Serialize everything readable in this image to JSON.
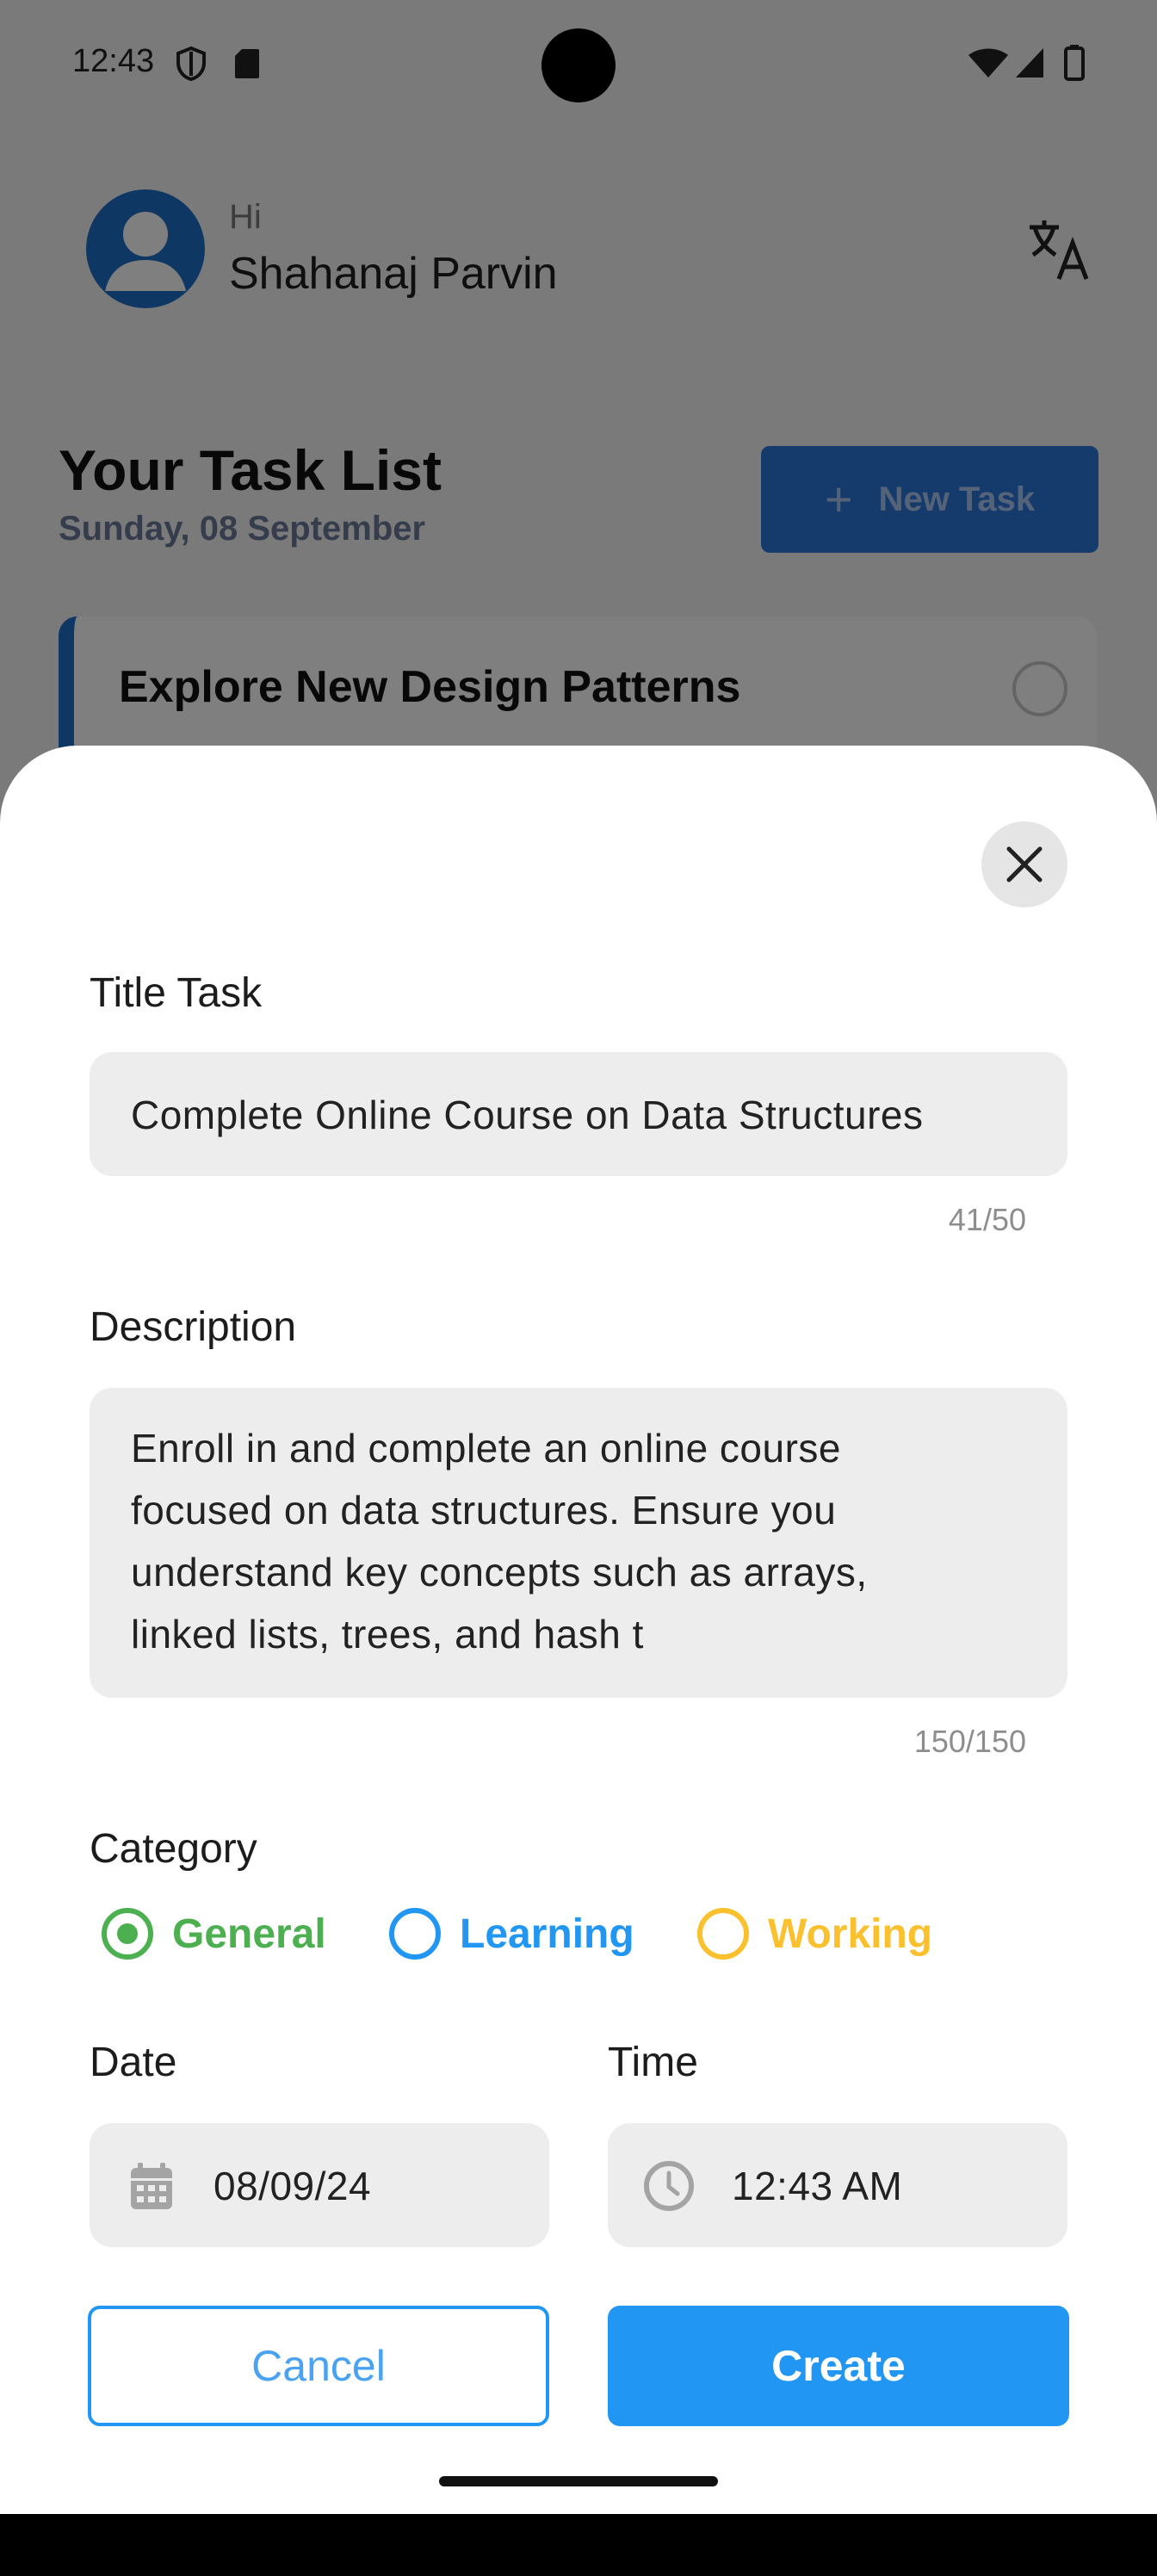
{
  "status_bar": {
    "time": "12:43",
    "left_icons": [
      "shield-icon",
      "sd-card-icon"
    ],
    "right_icons": [
      "wifi-icon",
      "signal-icon",
      "battery-icon"
    ]
  },
  "header": {
    "greeting": "Hi",
    "user_name": "Shahanaj Parvin",
    "avatar_icon": "person-avatar-icon",
    "language_icon": "translate-icon"
  },
  "task_list": {
    "title": "Your Task List",
    "date": "Sunday, 08 September",
    "new_task_label": "New Task",
    "tasks": [
      {
        "title": "Explore New Design Patterns"
      }
    ]
  },
  "sheet": {
    "close_icon": "close-icon",
    "title_label": "Title Task",
    "title_value": "Complete Online Course on Data Structures",
    "title_counter": "41/50",
    "description_label": "Description",
    "description_lines": [
      "Enroll in and complete an online course",
      "focused on data structures. Ensure you",
      "understand key concepts such as arrays,",
      "linked lists, trees, and hash t"
    ],
    "description_counter": "150/150",
    "category_label": "Category",
    "categories": [
      {
        "label": "General",
        "color": "#4caf50",
        "selected": true
      },
      {
        "label": "Learning",
        "color": "#2196f3",
        "selected": false
      },
      {
        "label": "Working",
        "color": "#fbc02d",
        "selected": false
      }
    ],
    "date_label": "Date",
    "date_value": "08/09/24",
    "date_icon": "calendar-icon",
    "time_label": "Time",
    "time_value": "12:43 AM",
    "time_icon": "clock-icon",
    "cancel_label": "Cancel",
    "create_label": "Create"
  },
  "colors": {
    "primary": "#2196f3",
    "avatar_blue": "#1f6fc8",
    "field_bg": "#ededed"
  }
}
